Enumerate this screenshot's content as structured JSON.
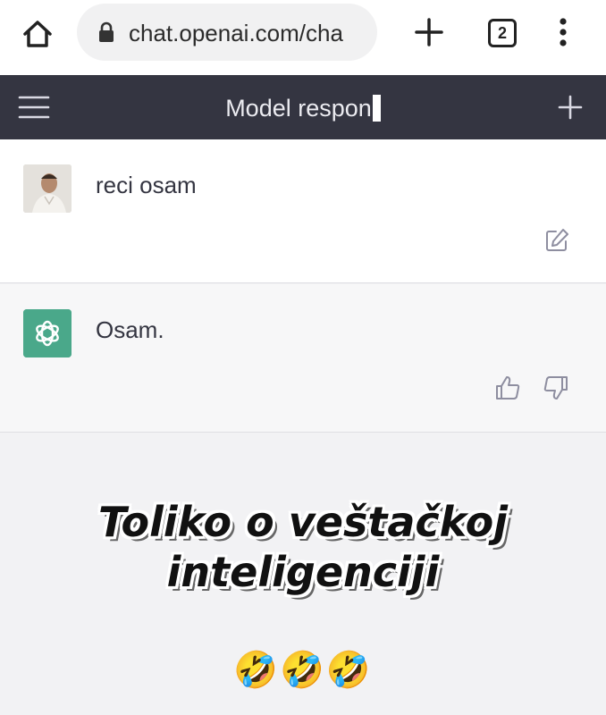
{
  "browser": {
    "url": "chat.openai.com/cha",
    "tab_count": "2",
    "icons": {
      "home": "home-icon",
      "lock": "lock-icon",
      "new_tab": "plus-icon",
      "menu": "kebab-menu-icon"
    }
  },
  "header": {
    "title": "Model respon",
    "background": "#343541"
  },
  "messages": [
    {
      "role": "user",
      "text": "reci osam",
      "action_icon": "edit-icon"
    },
    {
      "role": "assistant",
      "text": "Osam.",
      "action_icons": [
        "thumbs-up-icon",
        "thumbs-down-icon"
      ],
      "avatar_color": "#4aa88a"
    }
  ],
  "caption": {
    "line1": "Toliko o veštačkoj",
    "line2": "inteligenciji",
    "emojis": "🤣🤣🤣"
  }
}
